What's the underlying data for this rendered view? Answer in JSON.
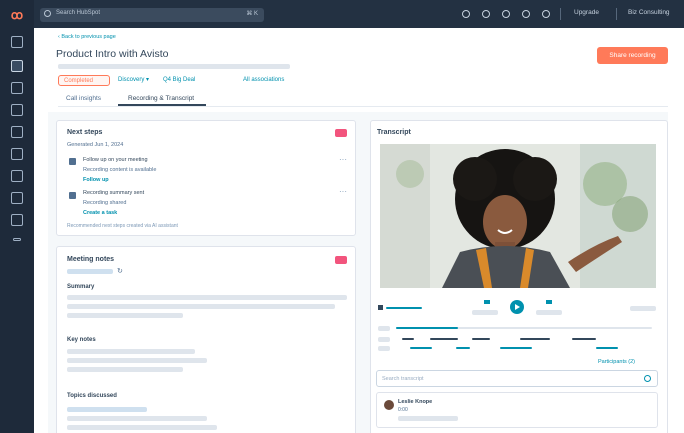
{
  "app": {
    "search_placeholder": "Search HubSpot",
    "search_shortcut": "⌘ K",
    "upgrade_label": "Upgrade",
    "account_label": "Biz Consulting"
  },
  "header": {
    "back_link": "‹ Back to previous page",
    "title": "Product Intro with Avisto",
    "primary_button": "Share recording",
    "status_chip": "Completed",
    "chips": [
      "Discovery ▾",
      "Q4 Big Deal",
      "All associations"
    ],
    "tabs": [
      "Call insights",
      "Recording & Transcript"
    ]
  },
  "next_steps": {
    "title": "Next steps",
    "date": "Generated Jun 1, 2024",
    "items": [
      {
        "line1": "Follow up on your meeting",
        "line2": "Recording content is available",
        "action": "Follow up"
      },
      {
        "line1": "Recording summary sent",
        "line2": "Recording shared",
        "action": "Create a task"
      }
    ],
    "footer": "Recommended next steps created via AI assistant"
  },
  "meeting_notes": {
    "title": "Meeting notes",
    "sections": [
      "Summary",
      "Key notes",
      "Topics discussed"
    ]
  },
  "transcript": {
    "title": "Transcript",
    "participants": "Participants (2)",
    "search_placeholder": "Search transcript",
    "speaker": "Leslie Knope",
    "speaker_sub": "0:00"
  },
  "colors": {
    "brand": "#ff7a59",
    "link": "#0091ae",
    "rail": "#1e2a3a",
    "badge": "#f2547d"
  }
}
